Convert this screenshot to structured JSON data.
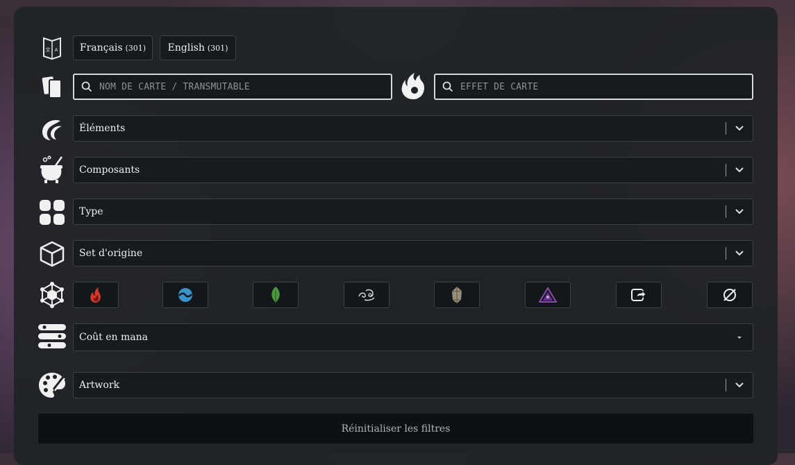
{
  "languages": [
    {
      "label": "Français",
      "count": "(301)"
    },
    {
      "label": "English",
      "count": "(301)"
    }
  ],
  "search": {
    "name_placeholder": "NOM DE CARTE / TRANSMUTABLE",
    "effect_placeholder": "EFFET DE CARTE"
  },
  "filters": {
    "elements": "Éléments",
    "components": "Composants",
    "type": "Type",
    "set": "Set d'origine",
    "mana": "Coût en mana",
    "artwork": "Artwork"
  },
  "element_buttons": [
    "fire-icon",
    "water-icon",
    "leaf-icon",
    "wind-icon",
    "stone-icon",
    "arcane-icon",
    "transfer-icon",
    "none-icon"
  ],
  "reset_label": "Réinitialiser les filtres",
  "colors": {
    "panel": "#1e2226",
    "border_light": "#d8d8d8",
    "fire": "#d33a2c",
    "water": "#3a93c9",
    "leaf": "#4a9a3c",
    "arcane": "#8a4cb0"
  }
}
